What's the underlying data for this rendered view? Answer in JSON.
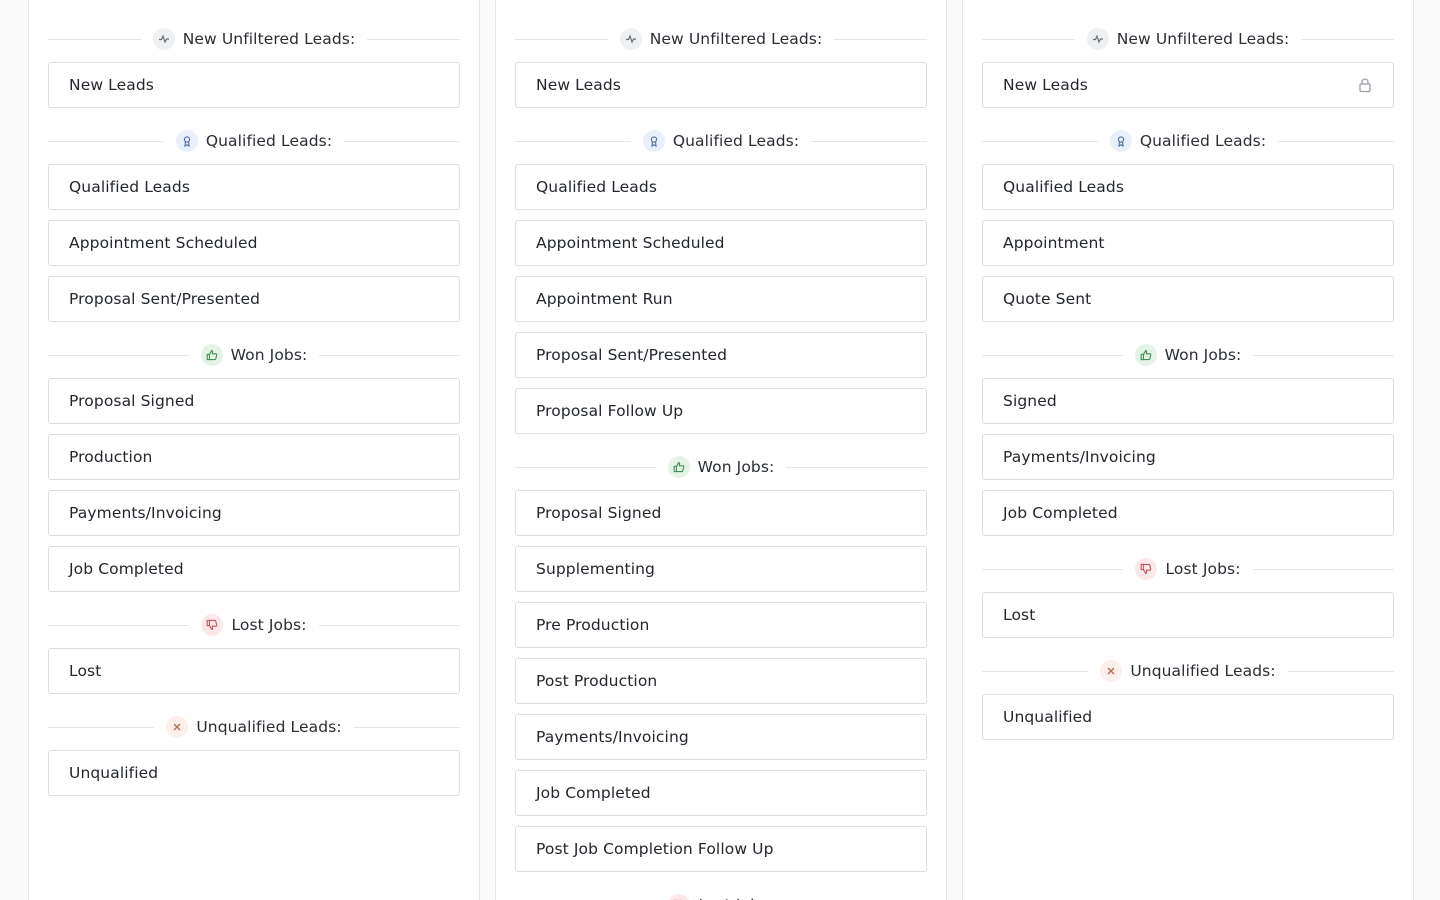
{
  "columns": [
    {
      "groups": [
        {
          "title": "New Unfiltered Leads:",
          "icon": "activity-icon",
          "stages": [
            "New Leads"
          ]
        },
        {
          "title": "Qualified Leads:",
          "icon": "badge-icon",
          "stages": [
            "Qualified Leads",
            "Appointment Scheduled",
            "Proposal Sent/Presented"
          ]
        },
        {
          "title": "Won Jobs:",
          "icon": "thumbs-up-icon",
          "stages": [
            "Proposal Signed",
            "Production",
            "Payments/Invoicing",
            "Job Completed"
          ]
        },
        {
          "title": "Lost Jobs:",
          "icon": "thumbs-down-icon",
          "stages": [
            "Lost"
          ]
        },
        {
          "title": "Unqualified Leads:",
          "icon": "x-icon",
          "stages": [
            "Unqualified"
          ]
        }
      ]
    },
    {
      "groups": [
        {
          "title": "New Unfiltered Leads:",
          "icon": "activity-icon",
          "stages": [
            "New Leads"
          ]
        },
        {
          "title": "Qualified Leads:",
          "icon": "badge-icon",
          "stages": [
            "Qualified Leads",
            "Appointment Scheduled",
            "Appointment Run",
            "Proposal Sent/Presented",
            "Proposal Follow Up"
          ]
        },
        {
          "title": "Won Jobs:",
          "icon": "thumbs-up-icon",
          "stages": [
            "Proposal Signed",
            "Supplementing",
            "Pre Production",
            "Post Production",
            "Payments/Invoicing",
            "Job Completed",
            "Post Job Completion Follow Up"
          ]
        },
        {
          "title": "Lost Jobs:",
          "icon": "thumbs-down-icon",
          "stages": []
        }
      ]
    },
    {
      "groups": [
        {
          "title": "New Unfiltered Leads:",
          "icon": "activity-icon",
          "stages": [
            "New Leads"
          ],
          "locked_first": true
        },
        {
          "title": "Qualified Leads:",
          "icon": "badge-icon",
          "stages": [
            "Qualified Leads",
            "Appointment",
            "Quote Sent"
          ]
        },
        {
          "title": "Won Jobs:",
          "icon": "thumbs-up-icon",
          "stages": [
            "Signed",
            "Payments/Invoicing",
            "Job Completed"
          ]
        },
        {
          "title": "Lost Jobs:",
          "icon": "thumbs-down-icon",
          "stages": [
            "Lost"
          ]
        },
        {
          "title": "Unqualified Leads:",
          "icon": "x-icon",
          "stages": [
            "Unqualified"
          ]
        }
      ]
    }
  ],
  "colors": {
    "won": "#3f8f52",
    "lost": "#c2555b",
    "qualified": "#4a6fa5"
  }
}
